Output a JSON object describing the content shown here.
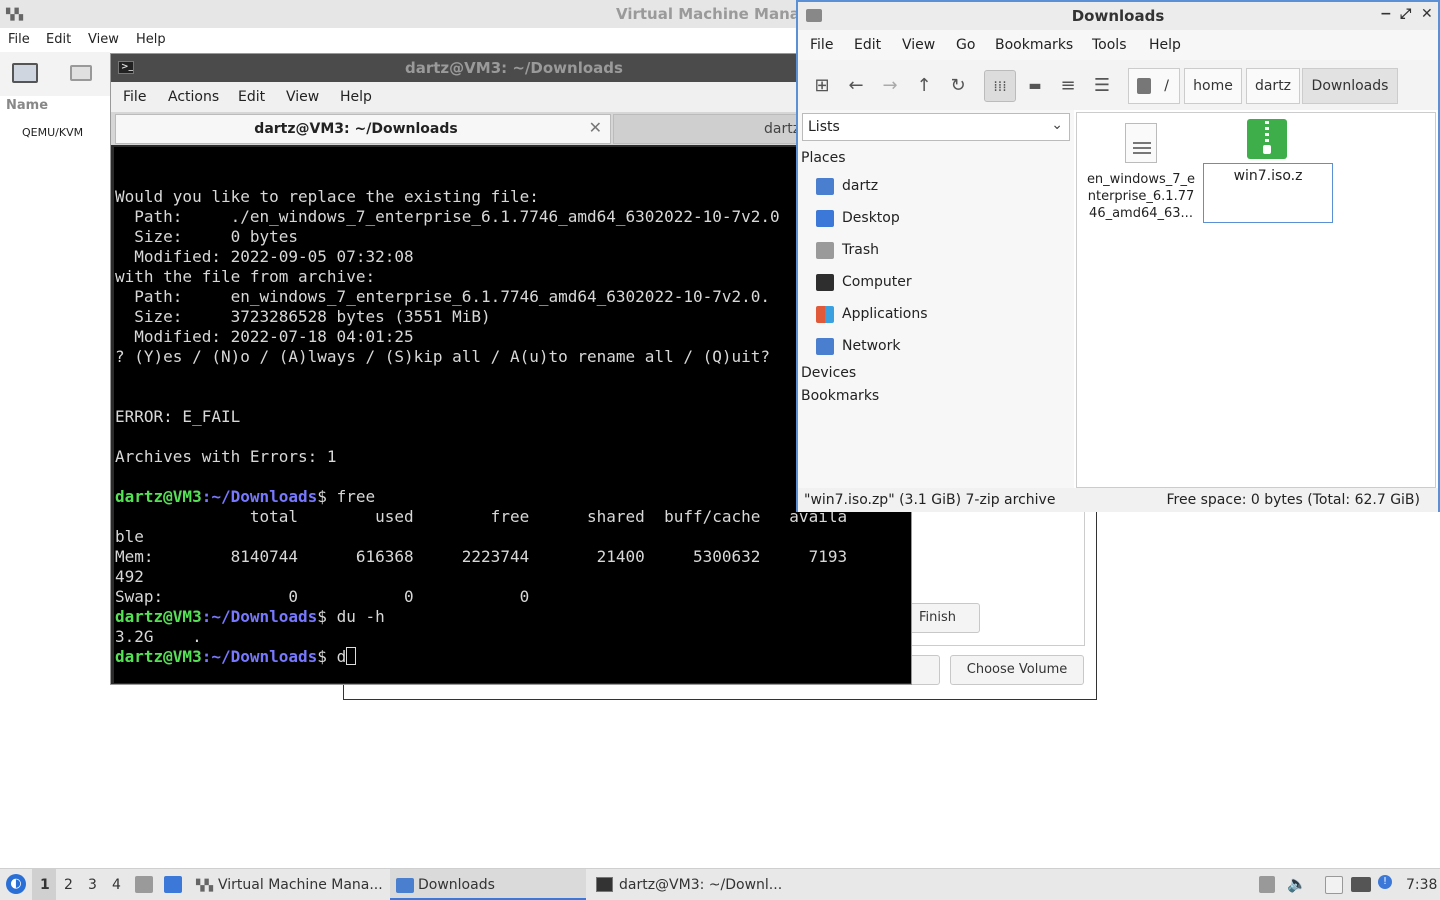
{
  "vmm": {
    "title": "Virtual Machine Mana",
    "menu": [
      "File",
      "Edit",
      "View",
      "Help"
    ],
    "column_name": "Name",
    "connection": "QEMU/KVM"
  },
  "dialog": {
    "finish": "Finish",
    "cancel_partial": "el",
    "choose_volume": "Choose Volume"
  },
  "terminal": {
    "title": "dartz@VM3: ~/Downloads",
    "menu": [
      "File",
      "Actions",
      "Edit",
      "View",
      "Help"
    ],
    "tab_active": "dartz@VM3: ~/Downloads",
    "tab_inactive": "dartz",
    "lines": [
      "",
      "Would you like to replace the existing file:",
      "  Path:     ./en_windows_7_enterprise_6.1.7746_amd64_6302022-10-7v2.0",
      "  Size:     0 bytes",
      "  Modified: 2022-09-05 07:32:08",
      "with the file from archive:",
      "  Path:     en_windows_7_enterprise_6.1.7746_amd64_6302022-10-7v2.0.",
      "  Size:     3723286528 bytes (3551 MiB)",
      "  Modified: 2022-07-18 04:01:25",
      "? (Y)es / (N)o / (A)lways / (S)kip all / A(u)to rename all / (Q)uit?",
      "",
      "",
      "ERROR: E_FAIL",
      "",
      "Archives with Errors: 1",
      ""
    ],
    "prompt_user": "dartz@VM3",
    "prompt_path": ":~/Downloads",
    "prompt_end": "$ ",
    "cmd_free": "free",
    "free_out": [
      "              total        used        free      shared  buff/cache   availa",
      "ble",
      "Mem:        8140744      616368     2223744       21400     5300632     7193",
      "492",
      "Swap:             0           0           0"
    ],
    "cmd_du": "du -h",
    "du_out": "3.2G    .",
    "cmd_current": "d"
  },
  "filemanager": {
    "title": "Downloads",
    "window_controls": [
      "−",
      "⤢",
      "✕"
    ],
    "menu": [
      "File",
      "Edit",
      "View",
      "Go",
      "Bookmarks",
      "Tools",
      "Help"
    ],
    "breadcrumbs": [
      "/",
      "home",
      "dartz",
      "Downloads"
    ],
    "side_mode": "Lists",
    "places_header": "Places",
    "places": [
      {
        "label": "dartz",
        "icon": "home-folder-icon",
        "color": "#4a7fcf"
      },
      {
        "label": "Desktop",
        "icon": "desktop-icon",
        "color": "#3c78d8"
      },
      {
        "label": "Trash",
        "icon": "trash-icon",
        "color": "#9a9a9a"
      },
      {
        "label": "Computer",
        "icon": "computer-icon",
        "color": "#2e2e2e"
      },
      {
        "label": "Applications",
        "icon": "applications-icon",
        "color": "#e05a3a"
      },
      {
        "label": "Network",
        "icon": "network-folder-icon",
        "color": "#4a7fcf"
      }
    ],
    "devices_header": "Devices",
    "bookmarks_header": "Bookmarks",
    "files": [
      {
        "name_lines": [
          "en_windows_7_e",
          "nterprise_6.1.77",
          "46_amd64_63..."
        ]
      },
      {
        "name": "win7.iso.z"
      }
    ],
    "status_left": "\"win7.iso.zp\" (3.1 GiB) 7-zip archive",
    "status_right": "Free space: 0 bytes (Total: 62.7 GiB)"
  },
  "taskbar": {
    "workspaces": [
      "1",
      "2",
      "3",
      "4"
    ],
    "tasks": [
      "Virtual Machine Mana...",
      "Downloads",
      "dartz@VM3: ~/Downl..."
    ],
    "clock": "7:38"
  }
}
